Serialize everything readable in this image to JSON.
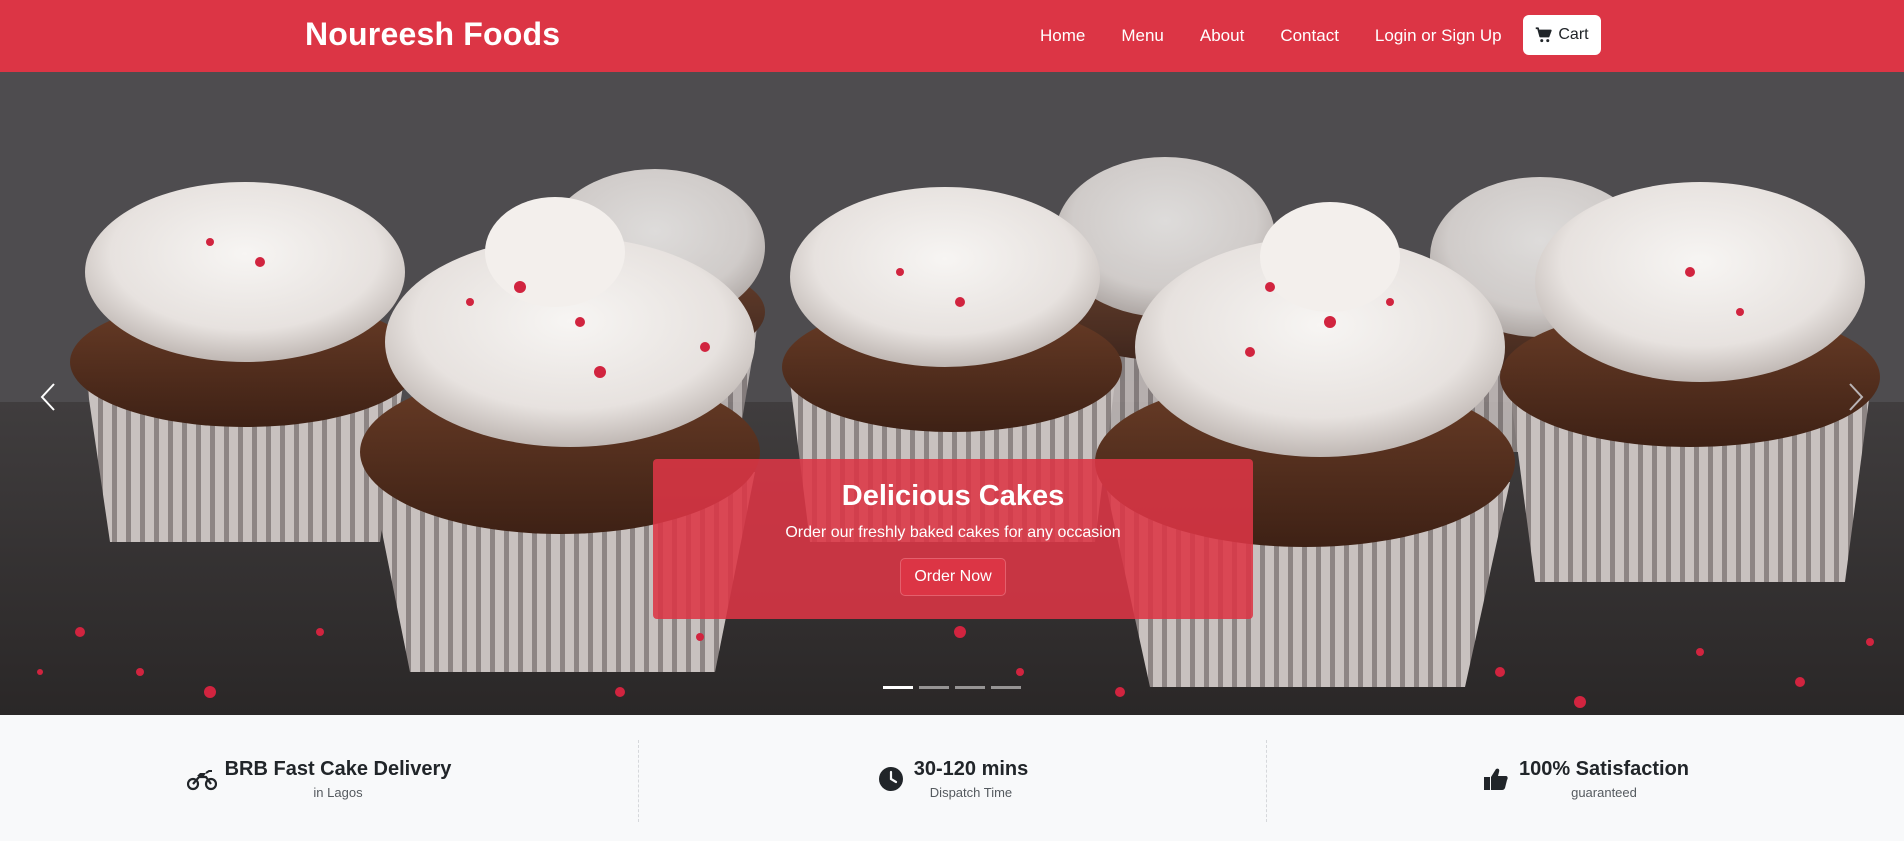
{
  "brand": {
    "name": "Noureesh Foods"
  },
  "nav": {
    "links": [
      "Home",
      "Menu",
      "About",
      "Contact",
      "Login or Sign Up"
    ],
    "cart_label": "Cart",
    "cart_icon": "cart-icon"
  },
  "colors": {
    "primary": "#dc3545",
    "light_bg": "#f8f9fa",
    "white": "#ffffff"
  },
  "hero": {
    "title": "Delicious Cakes",
    "subtitle": "Order our freshly baked cakes for any occasion",
    "cta_label": "Order Now",
    "prev_icon": "chevron-left-icon",
    "next_icon": "chevron-right-icon",
    "slides_count": 4,
    "active_slide": 1
  },
  "features": [
    {
      "title": "BRB Fast Cake Delivery",
      "subtitle": "in Lagos",
      "icon": "motorcycle-icon"
    },
    {
      "title": "30-120 mins",
      "subtitle": "Dispatch Time",
      "icon": "clock-icon"
    },
    {
      "title": "100% Satisfaction",
      "subtitle": "guaranteed",
      "icon": "thumbs-up-icon"
    }
  ]
}
